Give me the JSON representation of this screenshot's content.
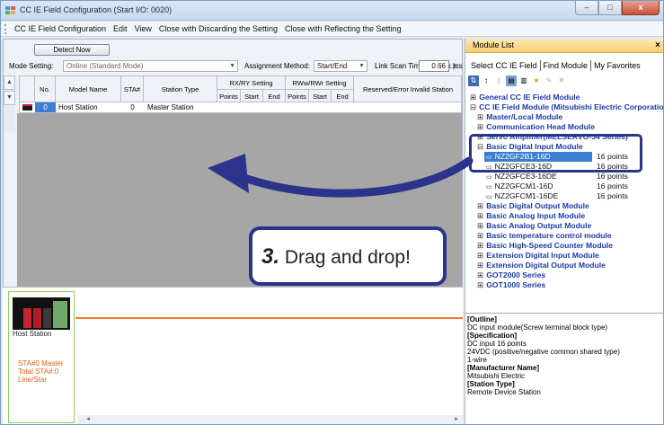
{
  "window": {
    "title": "CC IE Field Configuration (Start I/O: 0020)",
    "btn_minimize": "–",
    "btn_maximize": "□",
    "btn_close": "x"
  },
  "menu": [
    "CC IE Field Configuration",
    "Edit",
    "View",
    "Close with Discarding the Setting",
    "Close with Reflecting the Setting"
  ],
  "toolbar": {
    "detect_now": "Detect Now",
    "mode_label": "Mode Setting:",
    "mode_value": "Online (Standard Mode)",
    "assign_label": "Assignment Method:",
    "assign_value": "Start/End",
    "scan_label": "Link Scan Time (Approx.):",
    "scan_value": "0.66",
    "scan_unit": "ms"
  },
  "grid": {
    "headers": {
      "no": "No.",
      "model": "Model Name",
      "sta": "STA#",
      "type": "Station Type",
      "rxry": "RX/RY Setting",
      "rww": "RWw/RWr Setting",
      "reserved": "Reserved/Error Invalid Station",
      "points": "Points",
      "start": "Start",
      "end": "End",
      "points2": "Points",
      "start2": "Start",
      "end2": "End"
    },
    "rows": [
      {
        "no": "0",
        "model": "Host Station",
        "sta": "0",
        "type": "Master Station"
      }
    ]
  },
  "diagram": {
    "station_name": "Host Station",
    "info_line1": "STA#0  Master",
    "info_line2": "Total STA#:0",
    "info_line3": "Line/Star"
  },
  "module_list": {
    "title": "Module List",
    "close": "×",
    "tabs": [
      "Select CC IE Field",
      "Find Module",
      "My Favorites"
    ],
    "tree": [
      {
        "label": "General CC IE Field Module",
        "exp": "⊞"
      },
      {
        "label": "CC IE Field Module (Mitsubishi Electric Corporation)",
        "exp": "⊟"
      },
      {
        "label": "Master/Local Module",
        "exp": "⊞"
      },
      {
        "label": "Communication Head Module",
        "exp": "⊞"
      },
      {
        "label": "Servo Amplifier(MELSERVO-J4 Series)",
        "exp": "⊞"
      },
      {
        "label": "Basic Digital Input Module",
        "exp": "⊟"
      },
      {
        "label": "NZ2GF2B1-16D",
        "points": "16 points"
      },
      {
        "label": "NZ2GFCE3-16D",
        "points": "16 points"
      },
      {
        "label": "NZ2GFCE3-16DE",
        "points": "16 points"
      },
      {
        "label": "NZ2GFCM1-16D",
        "points": "16 points"
      },
      {
        "label": "NZ2GFCM1-16DE",
        "points": "16 points"
      },
      {
        "label": "Basic Digital Output Module",
        "exp": "⊞"
      },
      {
        "label": "Basic Analog Input Module",
        "exp": "⊞"
      },
      {
        "label": "Basic Analog Output Module",
        "exp": "⊞"
      },
      {
        "label": "Basic temperature control module",
        "exp": "⊞"
      },
      {
        "label": "Basic High-Speed Counter Module",
        "exp": "⊞"
      },
      {
        "label": "Extension Digital Input Module",
        "exp": "⊞"
      },
      {
        "label": "Extension Digital Output Module",
        "exp": "⊞"
      },
      {
        "label": "GOT2000 Series",
        "exp": "⊞"
      },
      {
        "label": "GOT1000 Series",
        "exp": "⊞"
      }
    ],
    "outline": {
      "h1": "[Outline]",
      "t1": "DC input module(Screw terminal block type)",
      "h2": "[Specification]",
      "t2a": "DC input 16 points",
      "t2b": "24VDC (positive/negative common shared type)",
      "t2c": "1-wire",
      "h3": "[Manufacturer Name]",
      "t3": "Mitsubishi Electric",
      "h4": "[Station Type]",
      "t4": "Remote Device Station"
    }
  },
  "callout": {
    "number": "3.",
    "text": "Drag and drop!"
  },
  "colors": {
    "accent": "#2b338a",
    "link_line": "#f07a2a",
    "station_text": "#e0601a",
    "selection": "#3c7fd1"
  }
}
